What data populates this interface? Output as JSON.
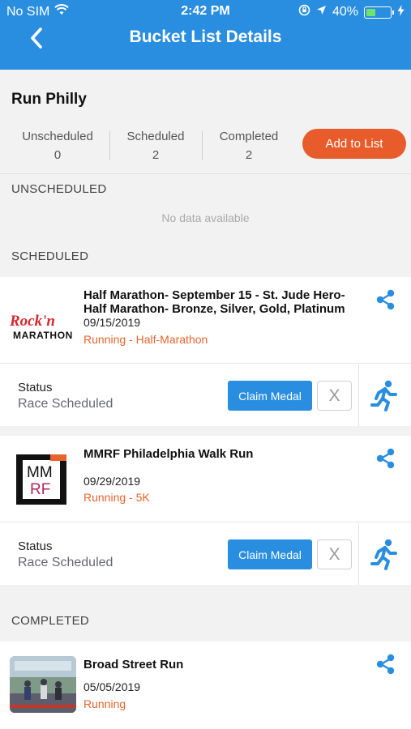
{
  "status_bar": {
    "carrier": "No SIM",
    "time": "2:42 PM",
    "battery": "40%",
    "battery_level": 0.4
  },
  "header": {
    "title": "Bucket List Details"
  },
  "summary": {
    "name": "Run Philly",
    "stats": [
      {
        "label": "Unscheduled",
        "value": "0"
      },
      {
        "label": "Scheduled",
        "value": "2"
      },
      {
        "label": "Completed",
        "value": "2"
      }
    ],
    "add_label": "Add to List"
  },
  "sections": {
    "unscheduled": "UNSCHEDULED",
    "no_data": "No data available",
    "scheduled": "SCHEDULED",
    "completed": "COMPLETED"
  },
  "scheduled": [
    {
      "title": "Half Marathon- September 15 - St. Jude Hero- Half Marathon- Bronze, Silver, Gold, Platinum",
      "date": "09/15/2019",
      "category": "Running - Half-Marathon",
      "logo_text_1": "Rock'n",
      "logo_text_2": "MARATHON",
      "status_label": "Status",
      "status_value": "Race Scheduled",
      "claim_label": "Claim Medal",
      "dismiss_label": "X"
    },
    {
      "title": "MMRF Philadelphia Walk Run",
      "date": "09/29/2019",
      "category": "Running - 5K",
      "logo_text_1": "MM",
      "logo_text_2": "RF",
      "status_label": "Status",
      "status_value": "Race Scheduled",
      "claim_label": "Claim Medal",
      "dismiss_label": "X"
    }
  ],
  "completed": [
    {
      "title": "Broad Street Run",
      "date": "05/05/2019",
      "category": "Running"
    }
  ],
  "colors": {
    "header": "#2a8ee0",
    "accent": "#e85c2c",
    "category": "#e8642c"
  }
}
